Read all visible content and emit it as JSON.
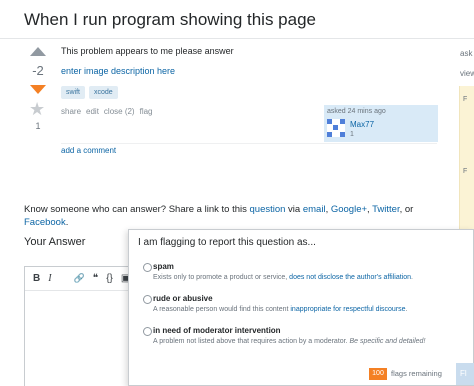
{
  "question": {
    "title": "When I run program showing this page",
    "vote_count": "-2",
    "favorite_count": "1",
    "body_text": "This problem appears to me please answer",
    "image_link": "enter image description here",
    "tags": [
      "swift",
      "xcode"
    ],
    "menu": {
      "share": "share",
      "edit": "edit",
      "close": "close (2)",
      "flag": "flag"
    },
    "asked": "asked 24 mins ago",
    "user_name": "Max77",
    "user_rep": "1",
    "add_comment": "add a comment"
  },
  "share": {
    "prefix": "Know someone who can answer? Share a link to this ",
    "question_link": "question",
    "via": " via ",
    "email": "email",
    "sep1": ", ",
    "googleplus": "Google+",
    "sep2": ", ",
    "twitter": "Twitter",
    "or": ", or ",
    "facebook": "Facebook",
    "end": "."
  },
  "answer": {
    "heading": "Your Answer",
    "toolbar": {
      "bold": "B",
      "italic": "I",
      "link": "🔗",
      "quote": "❝",
      "code": "{}",
      "image": "▣"
    }
  },
  "sidebar": {
    "asked": "ask",
    "viewed": "view",
    "f1": "F",
    "f2": "F"
  },
  "flag_dialog": {
    "title": "I am flagging to report this question as...",
    "options": [
      {
        "label": "spam",
        "desc_prefix": "Exists only to promote a product or service, ",
        "desc_link": "does not disclose the author's affiliation",
        "desc_suffix": "."
      },
      {
        "label": "rude or abusive",
        "desc_prefix": "A reasonable person would find this content ",
        "desc_link": "inappropriate for respectful discourse",
        "desc_suffix": "."
      },
      {
        "label": "in need of moderator intervention",
        "desc_prefix": "A problem not listed above that requires action by a moderator. ",
        "desc_em": "Be specific and detailed!"
      }
    ],
    "flags_remaining_count": "100",
    "flags_remaining_label": "flags remaining",
    "flag_button": "Fl"
  },
  "colors": {
    "accent": "#f48024",
    "link": "#0c65a5",
    "tag_bg": "#e1ecf4",
    "user_card_bg": "#d9eaf7"
  }
}
